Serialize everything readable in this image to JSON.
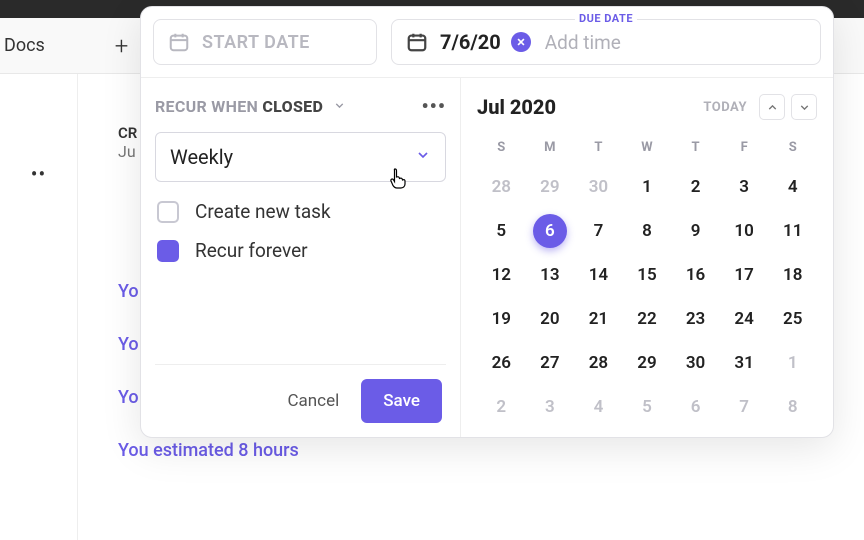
{
  "colors": {
    "accent": "#6b5ce7"
  },
  "background": {
    "docs_label": "Docs",
    "plus_label": "+",
    "sidebar_dots": "••",
    "cr_heading": "CR",
    "cr_sub": "Ju",
    "activity_prefix": "Yo",
    "activity_last": "You  estimated 8 hours"
  },
  "date_fields": {
    "start": {
      "placeholder": "START DATE"
    },
    "due": {
      "label": "DUE DATE",
      "value": "7/6/20",
      "add_time": "Add time"
    }
  },
  "recur": {
    "prefix": "RECUR WHEN",
    "mode": "CLOSED",
    "more": "•••",
    "frequency": "Weekly",
    "options": [
      {
        "key": "create_new_task",
        "label": "Create new task",
        "checked": false
      },
      {
        "key": "recur_forever",
        "label": "Recur forever",
        "checked": true
      }
    ]
  },
  "actions": {
    "cancel": "Cancel",
    "save": "Save"
  },
  "calendar": {
    "month_label": "Jul 2020",
    "today_label": "TODAY",
    "dow": [
      "S",
      "M",
      "T",
      "W",
      "T",
      "F",
      "S"
    ],
    "weeks": [
      [
        {
          "n": 28,
          "other": true
        },
        {
          "n": 29,
          "other": true
        },
        {
          "n": 30,
          "other": true
        },
        {
          "n": 1
        },
        {
          "n": 2
        },
        {
          "n": 3
        },
        {
          "n": 4
        }
      ],
      [
        {
          "n": 5
        },
        {
          "n": 6,
          "selected": true
        },
        {
          "n": 7
        },
        {
          "n": 8
        },
        {
          "n": 9
        },
        {
          "n": 10
        },
        {
          "n": 11
        }
      ],
      [
        {
          "n": 12
        },
        {
          "n": 13,
          "recur": true
        },
        {
          "n": 14
        },
        {
          "n": 15
        },
        {
          "n": 16
        },
        {
          "n": 17
        },
        {
          "n": 18
        }
      ],
      [
        {
          "n": 19
        },
        {
          "n": 20,
          "recur": true
        },
        {
          "n": 21
        },
        {
          "n": 22
        },
        {
          "n": 23
        },
        {
          "n": 24
        },
        {
          "n": 25
        }
      ],
      [
        {
          "n": 26
        },
        {
          "n": 27,
          "recur": true
        },
        {
          "n": 28
        },
        {
          "n": 29
        },
        {
          "n": 30
        },
        {
          "n": 31
        },
        {
          "n": 1,
          "other": true
        }
      ],
      [
        {
          "n": 2,
          "other": true
        },
        {
          "n": 3,
          "other": true,
          "recur": true
        },
        {
          "n": 4,
          "other": true
        },
        {
          "n": 5,
          "other": true
        },
        {
          "n": 6,
          "other": true
        },
        {
          "n": 7,
          "other": true
        },
        {
          "n": 8,
          "other": true
        }
      ]
    ]
  }
}
